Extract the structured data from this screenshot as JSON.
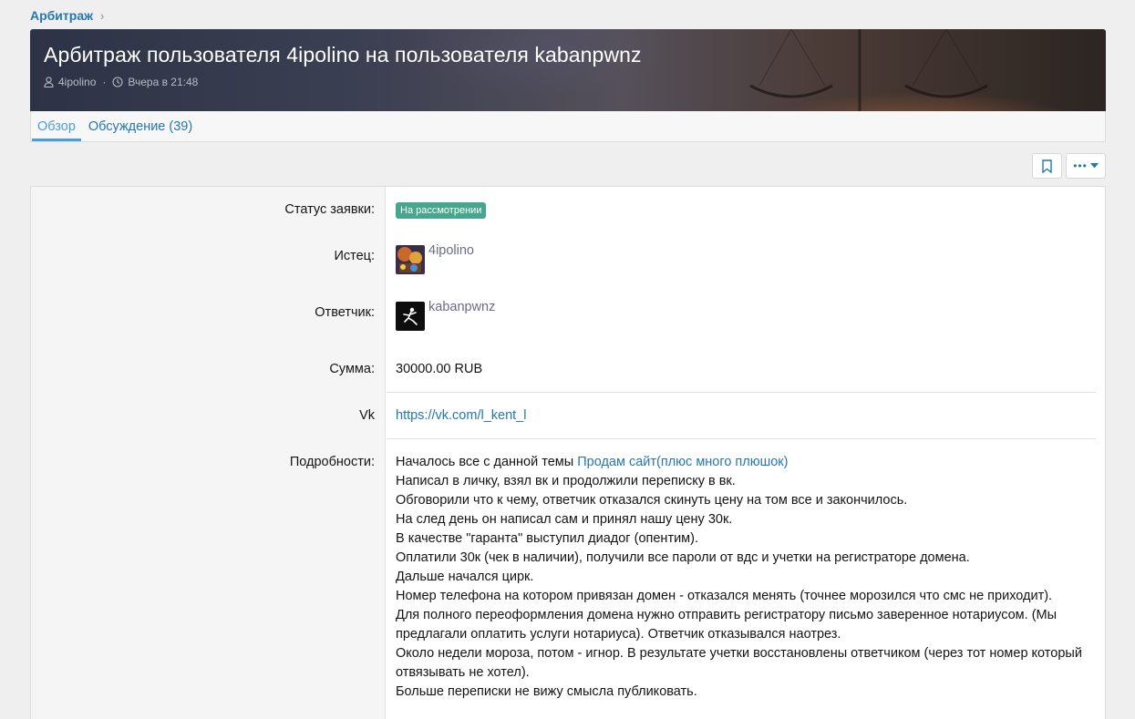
{
  "breadcrumb": {
    "item": "Арбитраж",
    "chevron": "›"
  },
  "banner": {
    "title": "Арбитраж пользователя 4ipolino на пользователя kabanpwnz",
    "author": "4ipolino",
    "date": "Вчера в 21:48",
    "separator": "·"
  },
  "tabs": [
    {
      "label": "Обзор",
      "active": true
    },
    {
      "label": "Обсуждение (39)",
      "active": false
    }
  ],
  "actions": {
    "bookmark_icon": "bookmark-icon",
    "more_label": "•••"
  },
  "fields": {
    "status": {
      "label": "Статус заявки:",
      "value": "На рассмотрении",
      "color": "#47a68e"
    },
    "plaintiff": {
      "label": "Истец:",
      "name": "4ipolino"
    },
    "defendant": {
      "label": "Ответчик:",
      "name": "kabanpwnz"
    },
    "amount": {
      "label": "Сумма:",
      "value": "30000.00 RUB"
    },
    "vk": {
      "label": "Vk",
      "value": "https://vk.com/l_kent_l"
    },
    "details": {
      "label": "Подробности:",
      "intro": "Началось все с данной темы ",
      "intro_link": "Продам сайт(плюс много плюшок)",
      "lines": [
        "Написал в личку, взял вк и продолжили переписку в вк.",
        "Обговорили что к чему, ответчик отказался скинуть цену на том все и закончилось.",
        "На след день он написал сам и принял нашу цену 30к.",
        "В качестве \"гаранта\" выступил диадог (опентим).",
        "Оплатили 30к (чек в наличии), получили все пароли от вдс и учетки на регистраторе домена.",
        "Дальше начался цирк.",
        "Номер телефона на котором привязан домен - отказался менять (точнее морозился что смс не приходит).",
        "Для полного переоформления домена нужно отправить регистратору письмо заверенное нотариусом. (Мы предлагали оплатить услуги нотариуса). Ответчик отказывался наотрез.",
        "Около недели мороза, потом - игнор. В результате учетки восстановлены ответчиком (через тот номер который отвязывать не хотел).",
        "Больше переписки не вижу смысла публиковать."
      ]
    }
  },
  "colors": {
    "accent": "#2577b1",
    "tab_active": "#4a9fd8"
  }
}
